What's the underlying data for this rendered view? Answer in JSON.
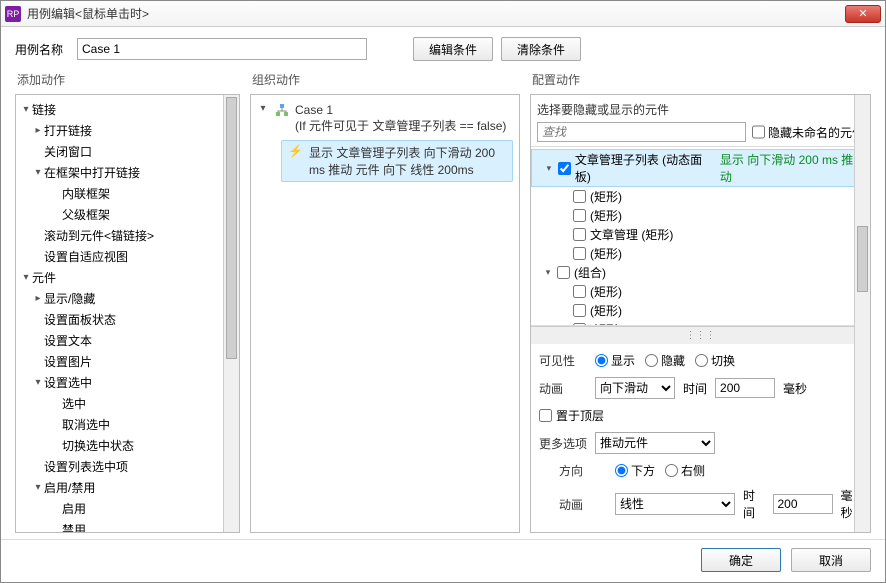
{
  "window": {
    "title": "用例编辑<鼠标单击时>"
  },
  "header": {
    "name_label": "用例名称",
    "name_value": "Case 1",
    "edit_cond": "编辑条件",
    "clear_cond": "清除条件"
  },
  "columns": {
    "add": "添加动作",
    "org": "组织动作",
    "cfg": "配置动作"
  },
  "left_tree": [
    {
      "exp": "▾",
      "label": "链接",
      "ind": 0
    },
    {
      "exp": "▸",
      "label": "打开链接",
      "ind": 1
    },
    {
      "exp": "",
      "label": "关闭窗口",
      "ind": 1
    },
    {
      "exp": "▾",
      "label": "在框架中打开链接",
      "ind": 1
    },
    {
      "exp": "",
      "label": "内联框架",
      "ind": 2
    },
    {
      "exp": "",
      "label": "父级框架",
      "ind": 2
    },
    {
      "exp": "",
      "label": "滚动到元件<锚链接>",
      "ind": 1
    },
    {
      "exp": "",
      "label": "设置自适应视图",
      "ind": 1
    },
    {
      "exp": "▾",
      "label": "元件",
      "ind": 0
    },
    {
      "exp": "▸",
      "label": "显示/隐藏",
      "ind": 1
    },
    {
      "exp": "",
      "label": "设置面板状态",
      "ind": 1
    },
    {
      "exp": "",
      "label": "设置文本",
      "ind": 1
    },
    {
      "exp": "",
      "label": "设置图片",
      "ind": 1
    },
    {
      "exp": "▾",
      "label": "设置选中",
      "ind": 1
    },
    {
      "exp": "",
      "label": "选中",
      "ind": 2
    },
    {
      "exp": "",
      "label": "取消选中",
      "ind": 2
    },
    {
      "exp": "",
      "label": "切换选中状态",
      "ind": 2
    },
    {
      "exp": "",
      "label": "设置列表选中项",
      "ind": 1
    },
    {
      "exp": "▾",
      "label": "启用/禁用",
      "ind": 1
    },
    {
      "exp": "",
      "label": "启用",
      "ind": 2
    },
    {
      "exp": "",
      "label": "禁用",
      "ind": 2
    }
  ],
  "mid": {
    "case_name": "Case 1",
    "condition": "(If 元件可见于 文章管理子列表 == false)",
    "action_prefix": "显示",
    "action_text": "文章管理子列表 向下滑动 200 ms 推动 元件 向下 线性 200ms"
  },
  "right": {
    "select_label": "选择要隐藏或显示的元件",
    "search_placeholder": "查找",
    "hide_unnamed": "隐藏未命名的元件",
    "widgets": [
      {
        "exp": "▾",
        "checked": true,
        "label": "文章管理子列表 (动态面板)",
        "extra": "显示 向下滑动 200 ms 推动",
        "ind": 0,
        "sel": true
      },
      {
        "exp": "",
        "checked": false,
        "label": "(矩形)",
        "ind": 1
      },
      {
        "exp": "",
        "checked": false,
        "label": "(矩形)",
        "ind": 1
      },
      {
        "exp": "",
        "checked": false,
        "label": "文章管理 (矩形)",
        "ind": 1
      },
      {
        "exp": "",
        "checked": false,
        "label": "(矩形)",
        "ind": 1
      },
      {
        "exp": "▾",
        "checked": false,
        "label": "(组合)",
        "ind": 0
      },
      {
        "exp": "",
        "checked": false,
        "label": "(矩形)",
        "ind": 1
      },
      {
        "exp": "",
        "checked": false,
        "label": "(矩形)",
        "ind": 1
      },
      {
        "exp": "",
        "checked": false,
        "label": "(矩形)",
        "ind": 1
      }
    ],
    "visibility_label": "可见性",
    "vis_show": "显示",
    "vis_hide": "隐藏",
    "vis_toggle": "切换",
    "anim_label": "动画",
    "anim_value": "向下滑动",
    "time_label": "时间",
    "time_value": "200",
    "ms": "毫秒",
    "bring_front": "置于顶层",
    "more_label": "更多选项",
    "more_value": "推动元件",
    "dir_label": "方向",
    "dir_down": "下方",
    "dir_right": "右侧",
    "anim2_label": "动画",
    "anim2_value": "线性",
    "time2_value": "200"
  },
  "footer": {
    "ok": "确定",
    "cancel": "取消"
  }
}
